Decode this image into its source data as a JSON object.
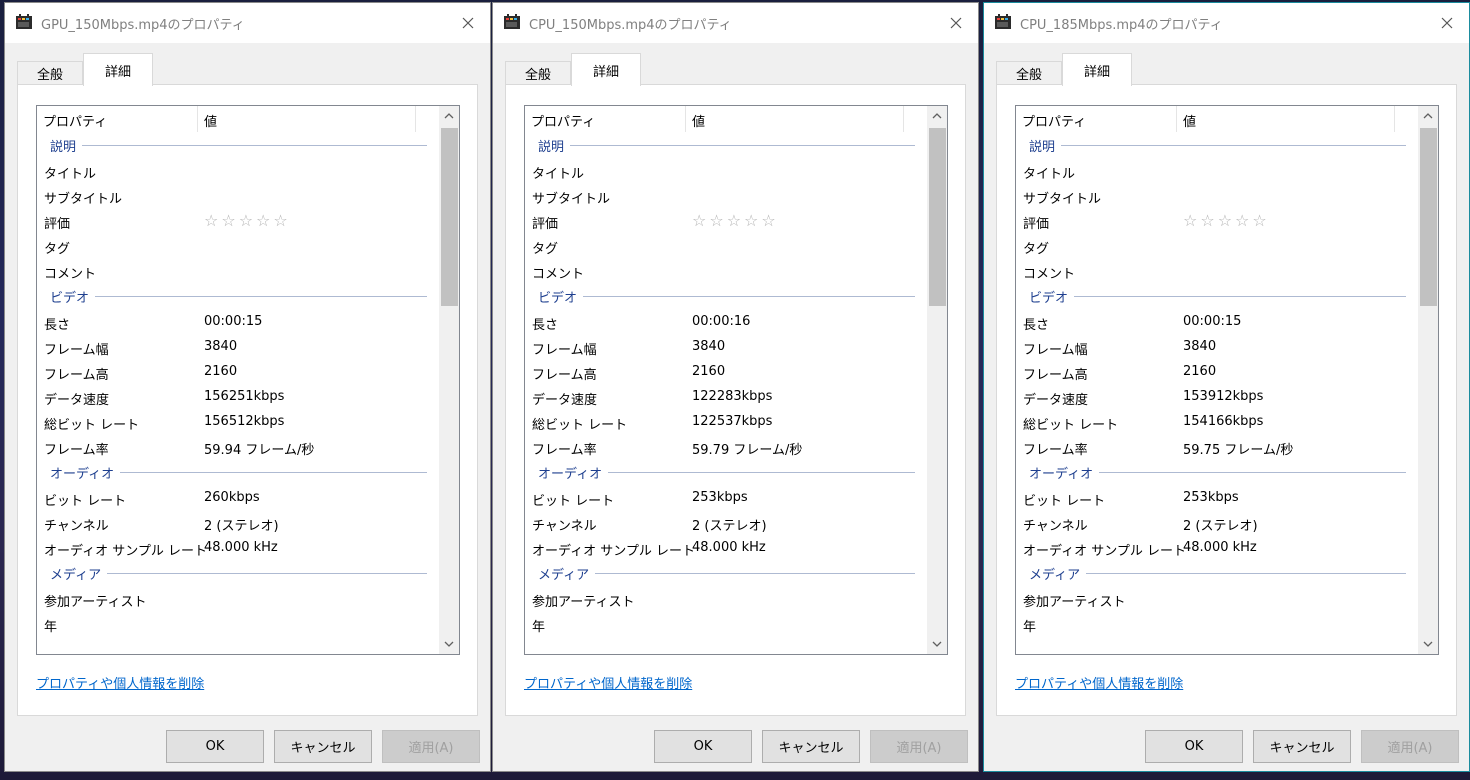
{
  "dialogs": [
    {
      "title": "GPU_150Mbps.mp4のプロパティ",
      "tabs": {
        "general": "全般",
        "details": "詳細"
      },
      "header": {
        "property": "プロパティ",
        "value": "値"
      },
      "rows": [
        {
          "type": "group",
          "label": "説明"
        },
        {
          "type": "item",
          "prop": "タイトル",
          "value": ""
        },
        {
          "type": "item",
          "prop": "サブタイトル",
          "value": ""
        },
        {
          "type": "rating",
          "prop": "評価",
          "value": "☆☆☆☆☆"
        },
        {
          "type": "item",
          "prop": "タグ",
          "value": ""
        },
        {
          "type": "item",
          "prop": "コメント",
          "value": ""
        },
        {
          "type": "group",
          "label": "ビデオ"
        },
        {
          "type": "item",
          "prop": "長さ",
          "value": "00:00:15"
        },
        {
          "type": "item",
          "prop": "フレーム幅",
          "value": "3840"
        },
        {
          "type": "item",
          "prop": "フレーム高",
          "value": "2160"
        },
        {
          "type": "item",
          "prop": "データ速度",
          "value": "156251kbps"
        },
        {
          "type": "item",
          "prop": "総ビット レート",
          "value": "156512kbps"
        },
        {
          "type": "item",
          "prop": "フレーム率",
          "value": "59.94 フレーム/秒"
        },
        {
          "type": "group",
          "label": "オーディオ"
        },
        {
          "type": "item",
          "prop": "ビット レート",
          "value": "260kbps"
        },
        {
          "type": "item",
          "prop": "チャンネル",
          "value": "2 (ステレオ)"
        },
        {
          "type": "item",
          "prop": "オーディオ サンプル レート",
          "value": "48.000 kHz"
        },
        {
          "type": "group",
          "label": "メディア"
        },
        {
          "type": "item",
          "prop": "参加アーティスト",
          "value": ""
        },
        {
          "type": "item",
          "prop": "年",
          "value": ""
        }
      ],
      "remove_link": "プロパティや個人情報を削除",
      "buttons": {
        "ok": "OK",
        "cancel": "キャンセル",
        "apply": "適用(A)"
      }
    },
    {
      "title": "CPU_150Mbps.mp4のプロパティ",
      "tabs": {
        "general": "全般",
        "details": "詳細"
      },
      "header": {
        "property": "プロパティ",
        "value": "値"
      },
      "rows": [
        {
          "type": "group",
          "label": "説明"
        },
        {
          "type": "item",
          "prop": "タイトル",
          "value": ""
        },
        {
          "type": "item",
          "prop": "サブタイトル",
          "value": ""
        },
        {
          "type": "rating",
          "prop": "評価",
          "value": "☆☆☆☆☆"
        },
        {
          "type": "item",
          "prop": "タグ",
          "value": ""
        },
        {
          "type": "item",
          "prop": "コメント",
          "value": ""
        },
        {
          "type": "group",
          "label": "ビデオ"
        },
        {
          "type": "item",
          "prop": "長さ",
          "value": "00:00:16"
        },
        {
          "type": "item",
          "prop": "フレーム幅",
          "value": "3840"
        },
        {
          "type": "item",
          "prop": "フレーム高",
          "value": "2160"
        },
        {
          "type": "item",
          "prop": "データ速度",
          "value": "122283kbps"
        },
        {
          "type": "item",
          "prop": "総ビット レート",
          "value": "122537kbps"
        },
        {
          "type": "item",
          "prop": "フレーム率",
          "value": "59.79 フレーム/秒"
        },
        {
          "type": "group",
          "label": "オーディオ"
        },
        {
          "type": "item",
          "prop": "ビット レート",
          "value": "253kbps"
        },
        {
          "type": "item",
          "prop": "チャンネル",
          "value": "2 (ステレオ)"
        },
        {
          "type": "item",
          "prop": "オーディオ サンプル レート",
          "value": "48.000 kHz"
        },
        {
          "type": "group",
          "label": "メディア"
        },
        {
          "type": "item",
          "prop": "参加アーティスト",
          "value": ""
        },
        {
          "type": "item",
          "prop": "年",
          "value": ""
        }
      ],
      "remove_link": "プロパティや個人情報を削除",
      "buttons": {
        "ok": "OK",
        "cancel": "キャンセル",
        "apply": "適用(A)"
      }
    },
    {
      "title": "CPU_185Mbps.mp4のプロパティ",
      "tabs": {
        "general": "全般",
        "details": "詳細"
      },
      "header": {
        "property": "プロパティ",
        "value": "値"
      },
      "rows": [
        {
          "type": "group",
          "label": "説明"
        },
        {
          "type": "item",
          "prop": "タイトル",
          "value": ""
        },
        {
          "type": "item",
          "prop": "サブタイトル",
          "value": ""
        },
        {
          "type": "rating",
          "prop": "評価",
          "value": "☆☆☆☆☆"
        },
        {
          "type": "item",
          "prop": "タグ",
          "value": ""
        },
        {
          "type": "item",
          "prop": "コメント",
          "value": ""
        },
        {
          "type": "group",
          "label": "ビデオ"
        },
        {
          "type": "item",
          "prop": "長さ",
          "value": "00:00:15"
        },
        {
          "type": "item",
          "prop": "フレーム幅",
          "value": "3840"
        },
        {
          "type": "item",
          "prop": "フレーム高",
          "value": "2160"
        },
        {
          "type": "item",
          "prop": "データ速度",
          "value": "153912kbps"
        },
        {
          "type": "item",
          "prop": "総ビット レート",
          "value": "154166kbps"
        },
        {
          "type": "item",
          "prop": "フレーム率",
          "value": "59.75 フレーム/秒"
        },
        {
          "type": "group",
          "label": "オーディオ"
        },
        {
          "type": "item",
          "prop": "ビット レート",
          "value": "253kbps"
        },
        {
          "type": "item",
          "prop": "チャンネル",
          "value": "2 (ステレオ)"
        },
        {
          "type": "item",
          "prop": "オーディオ サンプル レート",
          "value": "48.000 kHz"
        },
        {
          "type": "group",
          "label": "メディア"
        },
        {
          "type": "item",
          "prop": "参加アーティスト",
          "value": ""
        },
        {
          "type": "item",
          "prop": "年",
          "value": ""
        }
      ],
      "remove_link": "プロパティや個人情報を削除",
      "buttons": {
        "ok": "OK",
        "cancel": "キャンセル",
        "apply": "適用(A)"
      }
    }
  ]
}
